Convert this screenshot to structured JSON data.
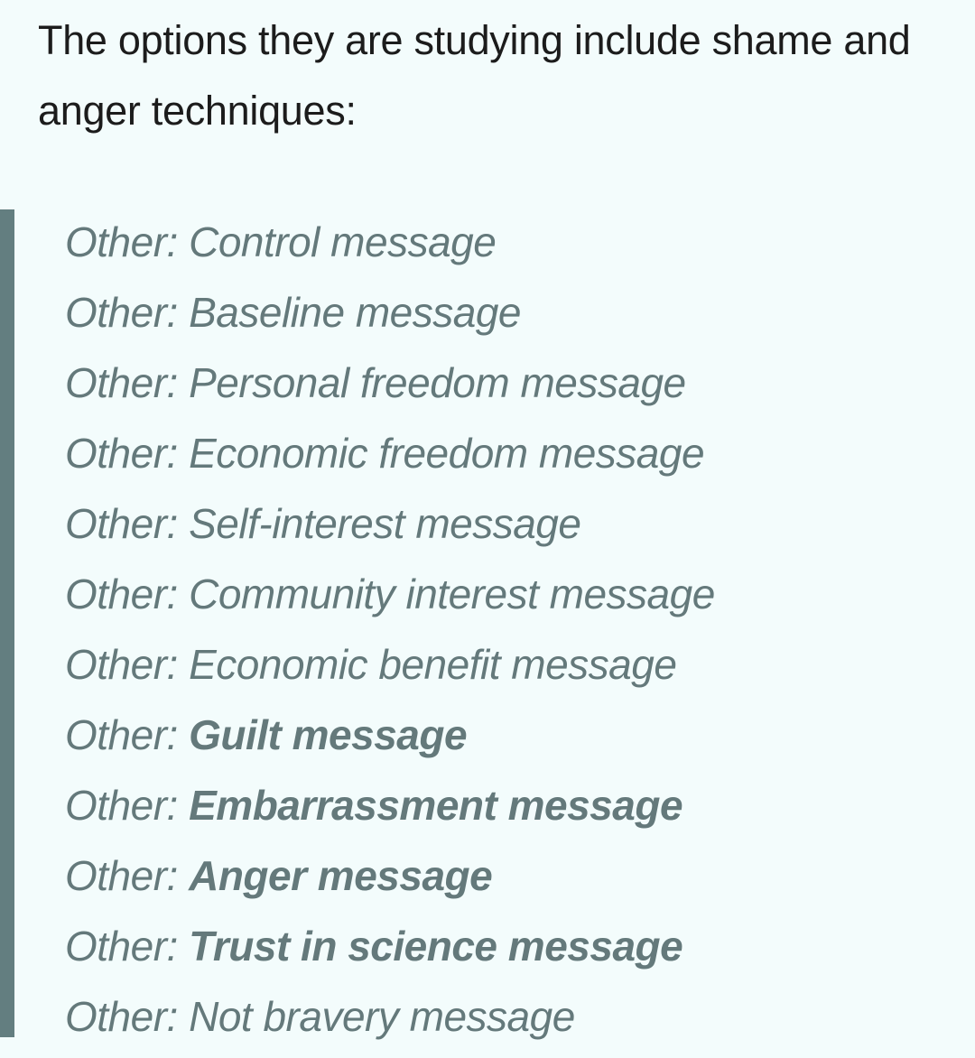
{
  "article": {
    "intro": "The options they are studying include shame and anger techniques:"
  },
  "options": [
    {
      "label": "Other:",
      "value": "Control message",
      "bold": false
    },
    {
      "label": "Other:",
      "value": "Baseline message",
      "bold": false
    },
    {
      "label": "Other:",
      "value": "Personal freedom message",
      "bold": false
    },
    {
      "label": "Other:",
      "value": "Economic freedom message",
      "bold": false
    },
    {
      "label": "Other:",
      "value": "Self-interest message",
      "bold": false
    },
    {
      "label": "Other:",
      "value": "Community interest message",
      "bold": false
    },
    {
      "label": "Other:",
      "value": "Economic benefit message",
      "bold": false
    },
    {
      "label": "Other:",
      "value": "Guilt message",
      "bold": true
    },
    {
      "label": "Other:",
      "value": "Embarrassment message",
      "bold": true
    },
    {
      "label": "Other:",
      "value": "Anger message",
      "bold": true
    },
    {
      "label": "Other:",
      "value": "Trust in science message",
      "bold": true
    },
    {
      "label": "Other:",
      "value": "Not bravery message",
      "bold": false
    }
  ],
  "colors": {
    "background": "#f3fcfc",
    "quote_bar": "#637e80",
    "quote_text": "#64797b",
    "body_text": "#1c1c1c"
  }
}
